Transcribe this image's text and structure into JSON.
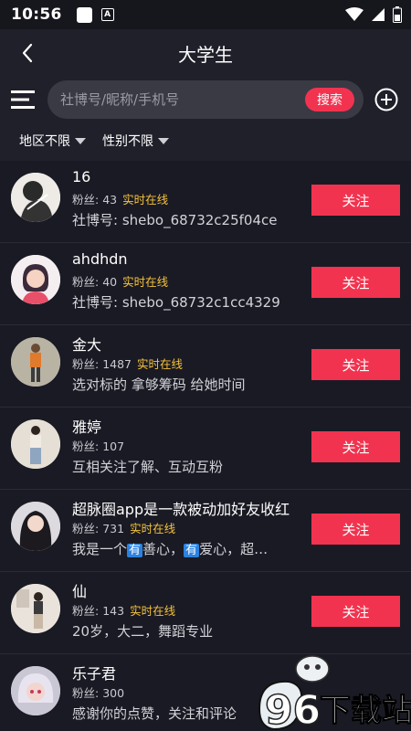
{
  "status_bar": {
    "time": "10:56",
    "a_icon": "A"
  },
  "header": {
    "title": "大学生"
  },
  "search": {
    "placeholder": "社博号/昵称/手机号",
    "button_label": "搜索"
  },
  "filters": {
    "region": "地区不限",
    "gender": "性别不限"
  },
  "users": [
    {
      "name": "16",
      "fans_label": "粉丝:",
      "fans": "43",
      "online": "实时在线",
      "desc": "社博号: shebo_68732c25f04ce",
      "follow": "关注"
    },
    {
      "name": "ahdhdn",
      "fans_label": "粉丝:",
      "fans": "40",
      "online": "实时在线",
      "desc": "社博号: shebo_68732c1cc4329",
      "follow": "关注"
    },
    {
      "name": "金大",
      "fans_label": "粉丝:",
      "fans": "1487",
      "online": "实时在线",
      "desc": "选对标的 拿够筹码 给她时间",
      "follow": "关注"
    },
    {
      "name": "雅婷",
      "fans_label": "粉丝:",
      "fans": "107",
      "online": "",
      "desc": "互相关注了解、互动互粉",
      "follow": "关注"
    },
    {
      "name": "超脉圈app是一款被动加好友收红",
      "fans_label": "粉丝:",
      "fans": "731",
      "online": "实时在线",
      "desc_parts": [
        "我是一个",
        "有",
        "善心，",
        "有",
        "爱心，超…"
      ],
      "follow": "关注"
    },
    {
      "name": "仙",
      "fans_label": "粉丝:",
      "fans": "143",
      "online": "实时在线",
      "desc": "20岁，大二，舞蹈专业",
      "follow": "关注"
    },
    {
      "name": "乐子君",
      "fans_label": "粉丝:",
      "fans": "300",
      "online": "",
      "desc": "感谢你的点赞，关注和评论",
      "follow": ""
    }
  ],
  "watermark": {
    "text": "下载站"
  },
  "colors": {
    "accent": "#f2334f",
    "online": "#f5c33b",
    "background": "#20202b",
    "list_background": "#1a1a24"
  }
}
